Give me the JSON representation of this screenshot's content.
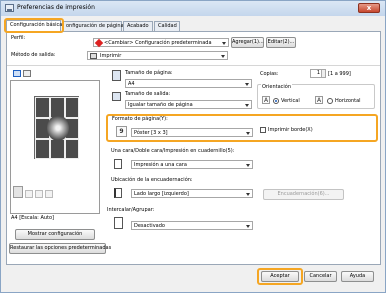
{
  "window": {
    "title": "Preferencias de impresión",
    "close_symbol": "x"
  },
  "tabs": [
    {
      "label": "Configuración básica",
      "active": true
    },
    {
      "label": "onfiguración de página",
      "active": false
    },
    {
      "label": "Acabado",
      "active": false
    },
    {
      "label": "Calidad",
      "active": false
    }
  ],
  "profile": {
    "label": "Perfil:",
    "value": "<Cambiar> Configuración predeterminada",
    "add_label": "Agregar(1)...",
    "edit_label": "Editar(2)..."
  },
  "output": {
    "label": "Método de salida:",
    "value": "Imprimir"
  },
  "preview": {
    "caption": "A4 [Escala: Auto]",
    "show_settings_label": "Mostrar configuración",
    "restore_label": "Restaurar las opciones predeterminadas"
  },
  "page_size": {
    "label": "Tamaño de página:",
    "value": "A4"
  },
  "output_size": {
    "label": "Tamaño de salida:",
    "value": "Igualar tamaño de página"
  },
  "copies": {
    "label": "Copias:",
    "value": "1",
    "range": "[1 a 999]"
  },
  "orientation": {
    "label": "Orientación",
    "portrait_label": "Vertical",
    "landscape_label": "Horizontal",
    "selected": "Vertical",
    "portrait_glyph": "A",
    "landscape_glyph": "A"
  },
  "page_layout": {
    "label": "Formato de página(Y):",
    "value": "Póster [3 x 3]",
    "icon_glyph": "9",
    "print_borders_label": "Imprimir borde(X)",
    "print_borders_checked": false
  },
  "duplex": {
    "label": "Una cara/Doble cara/Impresión en cuadernillo(5):",
    "value": "Impresión a una cara"
  },
  "binding": {
    "label": "Ubicación de la encuadernación:",
    "value": "Lado largo [izquierdo]",
    "binding_button_label": "Encuadernación(6)..."
  },
  "collate": {
    "label": "Intercalar/Agrupar:",
    "value": "Desactivado"
  },
  "footer": {
    "ok_label": "Aceptar",
    "cancel_label": "Cancelar",
    "help_label": "Ayuda"
  },
  "colors": {
    "highlight": "#f5a623",
    "selection": "#1f5fbf"
  }
}
